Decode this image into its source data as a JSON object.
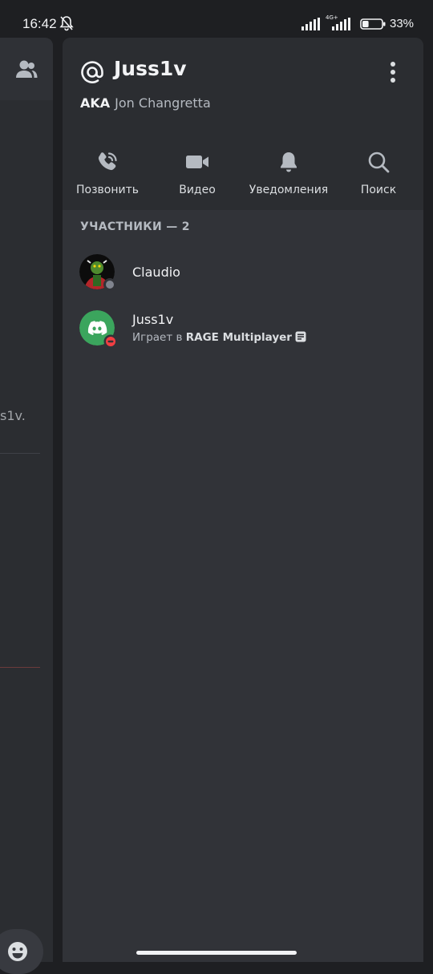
{
  "status_bar": {
    "time": "16:42",
    "network_type": "4G+",
    "battery_percent": "33%",
    "battery_level": 0.33,
    "icons": [
      "bell-off-icon",
      "signal-icon",
      "signal-icon",
      "battery-icon"
    ]
  },
  "background_panel": {
    "icon": "members-icon",
    "visible_text": "s1v.",
    "emoji_icon": "emoji-icon"
  },
  "drawer": {
    "at_symbol": "@",
    "username": "Juss1v",
    "aka_label": "AKA",
    "aka_name": "Jon Changretta",
    "more_icon": "more-vertical-icon",
    "actions": [
      {
        "label": "Позвонить",
        "icon": "phone-call-icon"
      },
      {
        "label": "Видео",
        "icon": "video-camera-icon"
      },
      {
        "label": "Уведомления",
        "icon": "bell-icon"
      },
      {
        "label": "Поиск",
        "icon": "search-icon"
      }
    ],
    "members_header": "УЧАСТНИКИ — 2",
    "members": [
      {
        "name": "Claudio",
        "status": "offline",
        "status_color": "#80848e",
        "avatar": "custom-avatar"
      },
      {
        "name": "Juss1v",
        "status": "dnd",
        "status_color": "#f23f43",
        "avatar": "discord-default-avatar",
        "activity_prefix": "Играет в",
        "activity_name": "RAGE Multiplayer",
        "activity_icon": "rich-presence-icon"
      }
    ]
  },
  "colors": {
    "background": "#1e1f22",
    "drawer": "#313338",
    "header": "#2b2d31",
    "discord_green_avatar": "#3ba55d"
  }
}
